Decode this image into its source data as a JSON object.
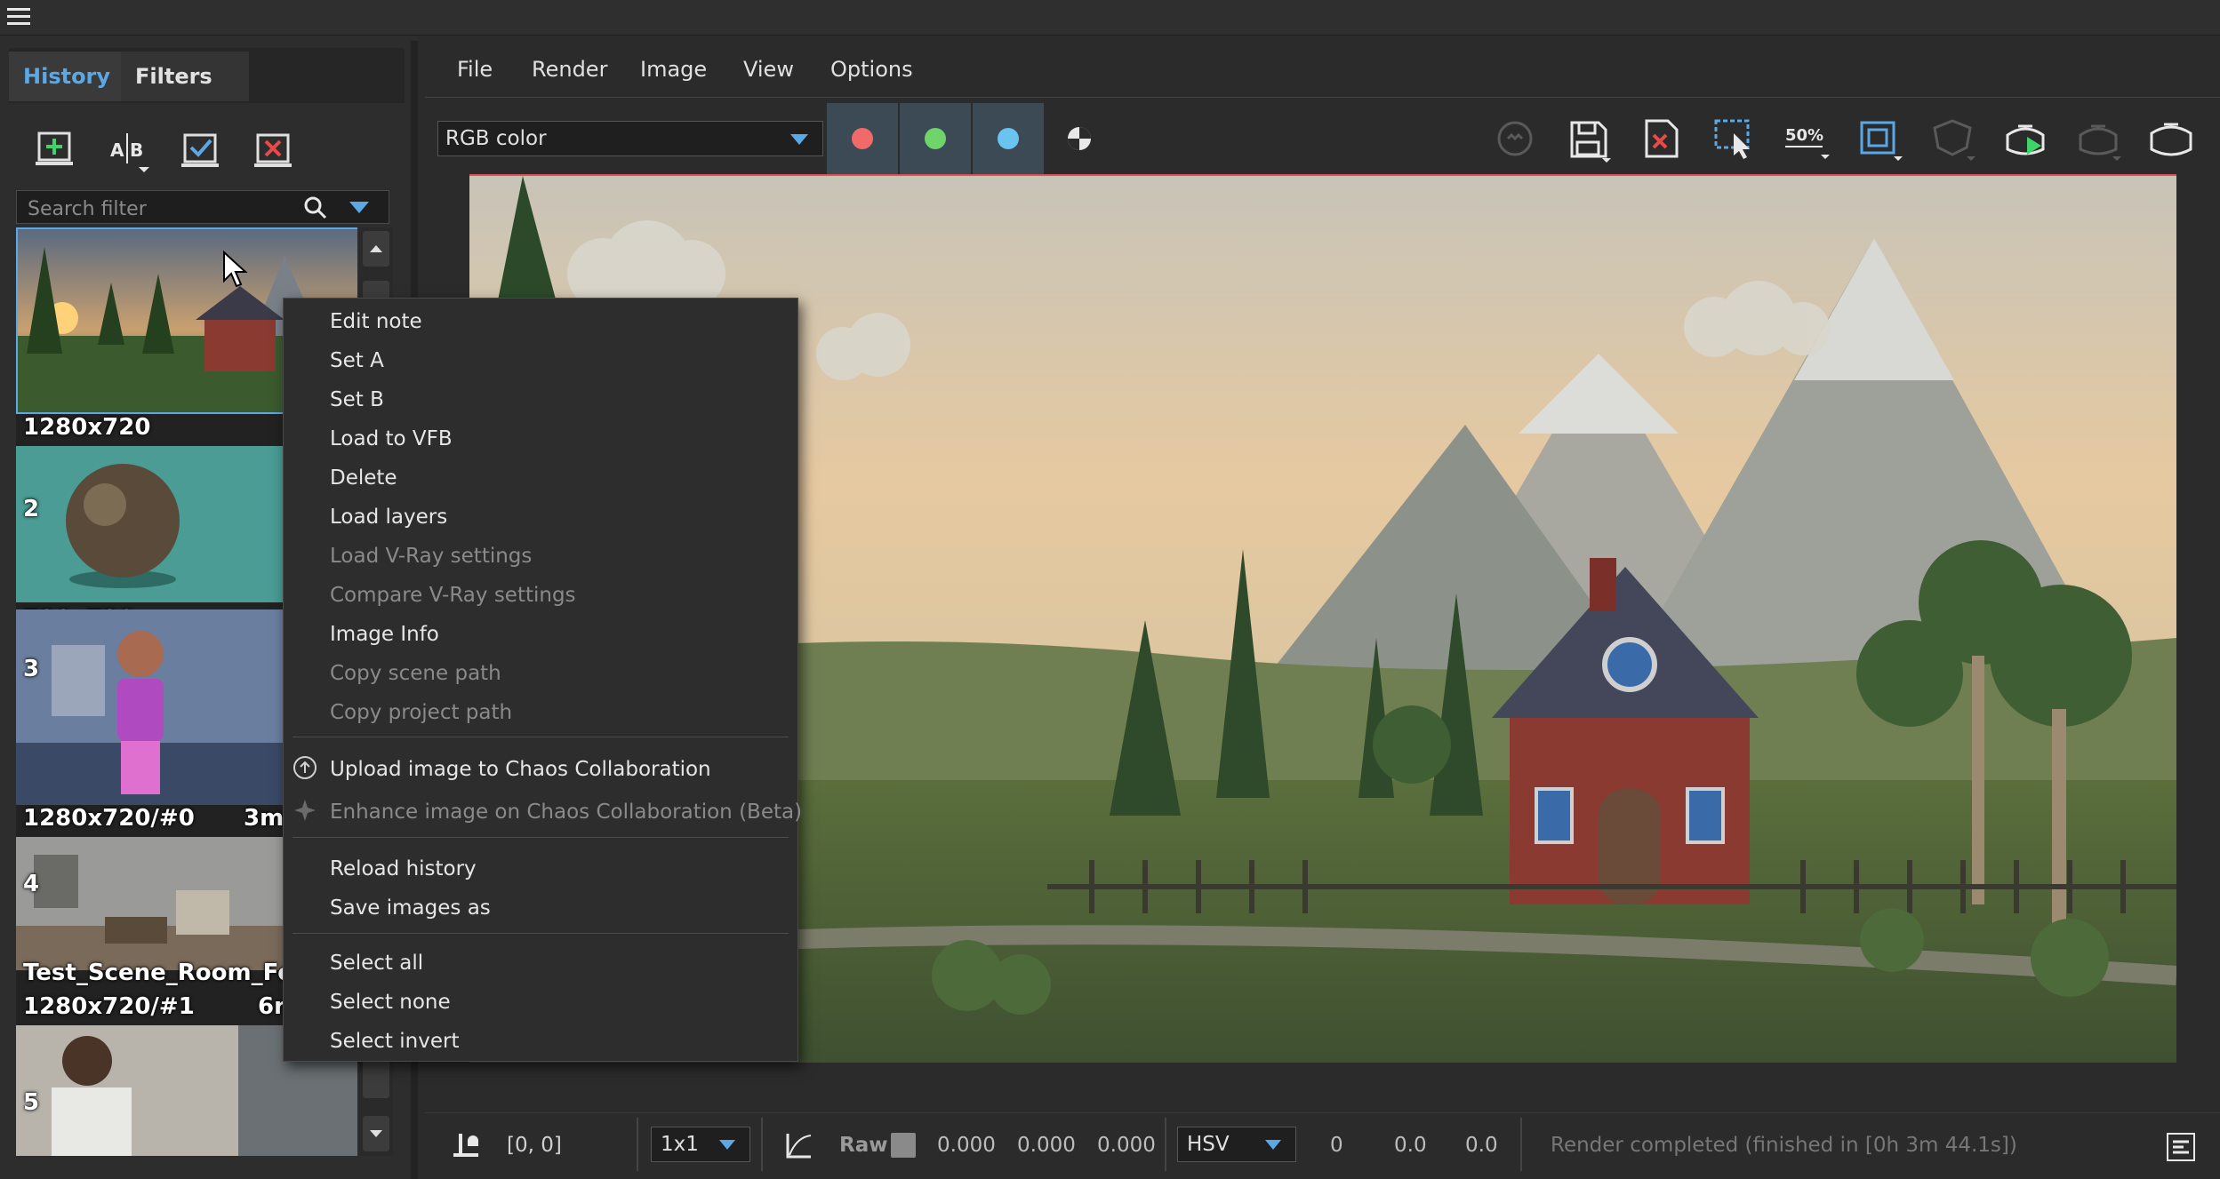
{
  "left_panel": {
    "tabs": [
      {
        "label": "History"
      },
      {
        "label": "Filters"
      }
    ],
    "search": {
      "placeholder": "Search filter"
    },
    "thumbnails": [
      {
        "label": "1280x720"
      },
      {
        "label": "2"
      },
      {
        "label": "720x720"
      },
      {
        "label": "3"
      },
      {
        "label": "1280x720/#0"
      },
      {
        "label": "3m"
      },
      {
        "label": "4"
      },
      {
        "label": "Test_Scene_Room_Fo"
      },
      {
        "label": "1280x720/#1"
      },
      {
        "label": "6r"
      },
      {
        "label": "5"
      }
    ]
  },
  "menubar": {
    "items": [
      {
        "label": "File"
      },
      {
        "label": "Render"
      },
      {
        "label": "Image"
      },
      {
        "label": "View"
      },
      {
        "label": "Options"
      }
    ]
  },
  "toolbar": {
    "channel": "RGB color",
    "channel_colors": {
      "red": "#f06a6a",
      "green": "#6fd46a",
      "blue": "#6ac4f0"
    },
    "zoom_label": "50%"
  },
  "context_menu": {
    "items": [
      {
        "label": "Edit note",
        "enabled": true
      },
      {
        "label": "Set A",
        "enabled": true
      },
      {
        "label": "Set B",
        "enabled": true
      },
      {
        "label": "Load to VFB",
        "enabled": true
      },
      {
        "label": "Delete",
        "enabled": true
      },
      {
        "label": "Load layers",
        "enabled": true
      },
      {
        "label": "Load V-Ray settings",
        "enabled": false
      },
      {
        "label": "Compare V-Ray settings",
        "enabled": false
      },
      {
        "label": "Image Info",
        "enabled": true
      },
      {
        "label": "Copy scene path",
        "enabled": false
      },
      {
        "label": "Copy project path",
        "enabled": false
      },
      {
        "label": "Upload image to Chaos Collaboration",
        "enabled": true
      },
      {
        "label": "Enhance image on Chaos Collaboration (Beta)",
        "enabled": false
      },
      {
        "label": "Reload history",
        "enabled": true
      },
      {
        "label": "Save images as",
        "enabled": true
      },
      {
        "label": "Select all",
        "enabled": true
      },
      {
        "label": "Select none",
        "enabled": true
      },
      {
        "label": "Select invert",
        "enabled": true
      }
    ]
  },
  "statusbar": {
    "coords": "[0, 0]",
    "ratio": "1x1",
    "raw_label": "Raw",
    "rgb_values": [
      "0.000",
      "0.000",
      "0.000"
    ],
    "color_mode": "HSV",
    "hsv_values": [
      "0",
      "0.0",
      "0.0"
    ],
    "message": "Render completed (finished in [0h  3m 44.1s])"
  }
}
